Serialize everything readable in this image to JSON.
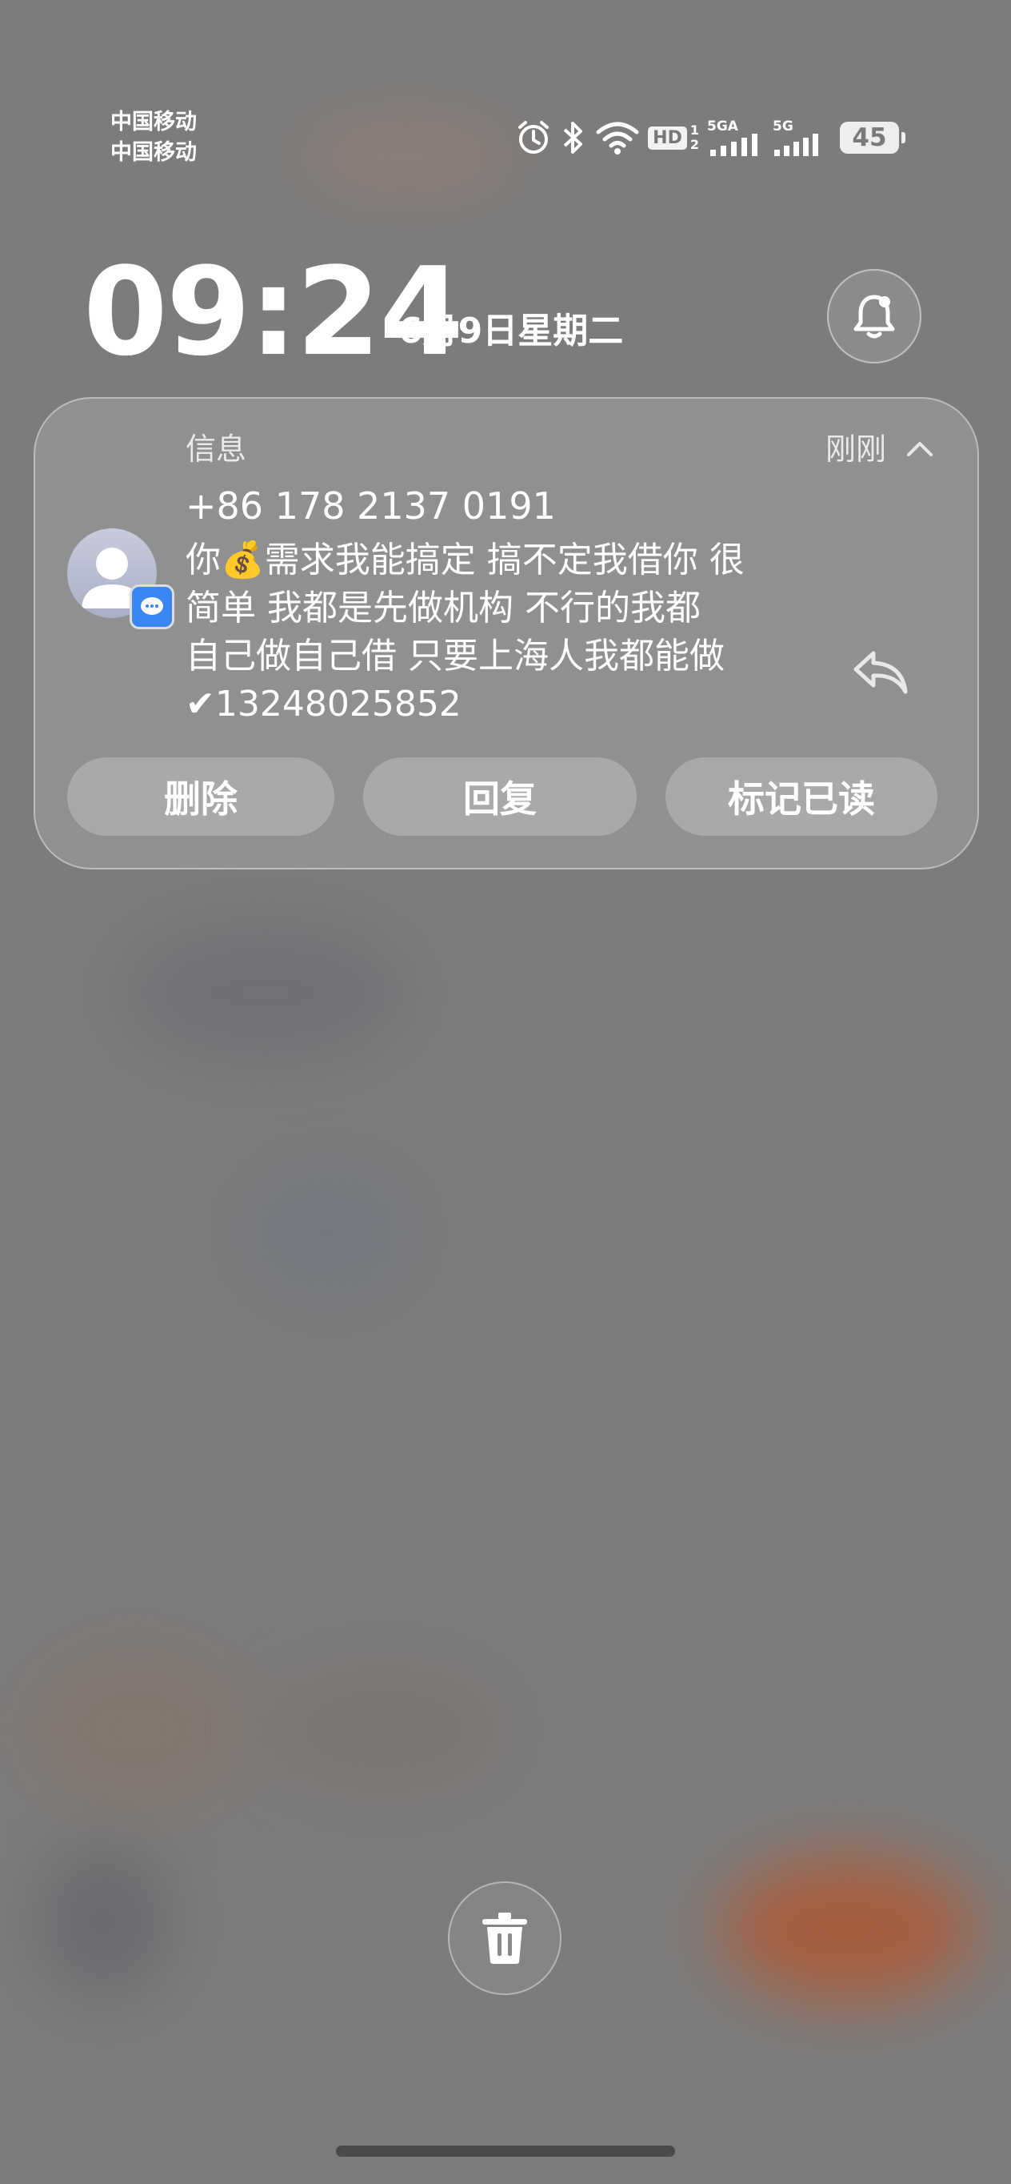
{
  "status_bar": {
    "carrier_1": "中国移动",
    "carrier_2": "中国移动",
    "hd_label": "HD",
    "hd_sim_1": "1",
    "hd_sim_2": "2",
    "net_1": "5GA",
    "net_2": "5G",
    "battery": "45",
    "icons": [
      "alarm-icon",
      "bluetooth-icon",
      "wifi-icon",
      "signal-icon",
      "battery-icon"
    ]
  },
  "lock": {
    "time": "09:24",
    "date": "6月9日星期二"
  },
  "notification": {
    "app_name": "信息",
    "time_ago": "刚刚",
    "sender": "+86 178 2137 0191",
    "body": "你💰需求我能搞定 搞不定我借你 很\n简单 我都是先做机构 不行的我都\n自己做自己借 只要上海人我都能做\n✔13248025852",
    "actions": {
      "delete": "删除",
      "reply": "回复",
      "mark_read": "标记已读"
    }
  },
  "colors": {
    "badge_blue": "#3a86f2",
    "background": "#7c7c7c"
  }
}
